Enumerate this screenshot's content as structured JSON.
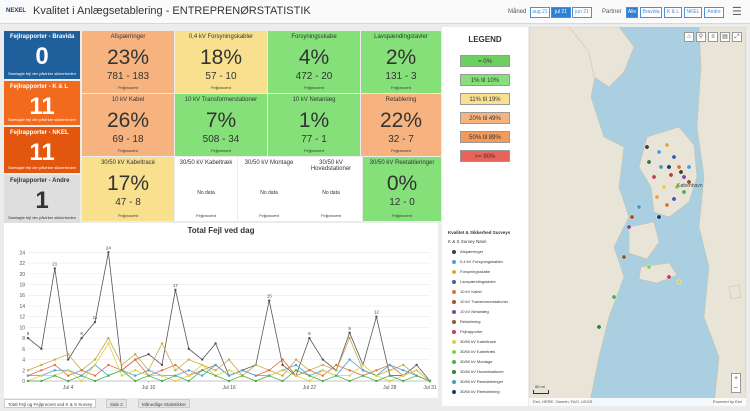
{
  "header": {
    "logo": "NEXEL",
    "title": "Kvalitet i Anlægsetablering - ENTREPRENØRSTATISTIK",
    "month_label": "Måned",
    "months": [
      {
        "label": "aug 21",
        "active": false
      },
      {
        "label": "jul 21",
        "active": true
      },
      {
        "label": "jun 21",
        "active": false
      }
    ],
    "partner_label": "Partner",
    "partners": [
      {
        "label": "Alle",
        "active": true
      },
      {
        "label": "Bravida",
        "active": false
      },
      {
        "label": "K & L",
        "active": false
      },
      {
        "label": "NKEL",
        "active": false
      },
      {
        "label": "Andre",
        "active": false
      }
    ],
    "menu_icon": "hamburger-icon"
  },
  "side_tiles": [
    {
      "title": "Fejlrapporter - Bravida",
      "value": "0",
      "caption": "Samlagte fejl der påvirker sikkerheden",
      "color": "#1f5f9c"
    },
    {
      "title": "Fejlrapporter - K & L",
      "value": "11",
      "caption": "Samlagte fejl der påvirker sikkerheden",
      "color": "#f26a1b"
    },
    {
      "title": "Fejlrapporter - NKEL",
      "value": "11",
      "caption": "Samlagte fejl der påvirker sikkerheden",
      "color": "#e2560e"
    },
    {
      "title": "Fejlrapporter - Andre",
      "value": "1",
      "caption": "Samlagte fejl der påvirker sikkerheden",
      "color": "#dedede",
      "text_color": "#333"
    }
  ],
  "kpi_tiles": [
    {
      "title": "Afspærringer",
      "value": "23%",
      "sub": "781 - 183",
      "caption": "Fejlprocent",
      "color": "#f7b37f"
    },
    {
      "title": "0,4 kV Forsyningskabler",
      "value": "18%",
      "sub": "57 - 10",
      "caption": "Fejlprocent",
      "color": "#f9e08f"
    },
    {
      "title": "Forsyningsskabe",
      "value": "4%",
      "sub": "472 - 20",
      "caption": "Fejlprocent",
      "color": "#85e07a"
    },
    {
      "title": "Lavspændingstavler",
      "value": "2%",
      "sub": "131 - 3",
      "caption": "Fejlprocent",
      "color": "#85e07a"
    },
    {
      "title": "10 kV Kabel",
      "value": "26%",
      "sub": "69 - 18",
      "caption": "Fejlprocent",
      "color": "#f7b37f"
    },
    {
      "title": "10 kV Transformerstationer",
      "value": "7%",
      "sub": "508 - 34",
      "caption": "Fejlprocent",
      "color": "#85e07a"
    },
    {
      "title": "10 kV Netanlæg",
      "value": "1%",
      "sub": "77 - 1",
      "caption": "Fejlprocent",
      "color": "#85e07a"
    },
    {
      "title": "Retablering",
      "value": "22%",
      "sub": "32 - 7",
      "caption": "Fejlprocent",
      "color": "#f7b37f"
    },
    {
      "title": "30/50 kV Kabeltracé",
      "value": "17%",
      "sub": "47 - 8",
      "caption": "Fejlprocent",
      "color": "#f9e08f"
    },
    {
      "title": "30/50 kV Kabeltræk",
      "value": "",
      "sub": "No data",
      "caption": "Fejlprocent",
      "color": "#ffffff"
    },
    {
      "title": "30/50 kV Montage",
      "value": "",
      "sub": "No data",
      "caption": "Fejlprocent",
      "color": "#ffffff"
    },
    {
      "title": "30/50 kV Hovedstationer",
      "value": "",
      "sub": "No data",
      "caption": "Fejlprocent",
      "color": "#ffffff"
    },
    {
      "title": "30/50 kV Reetableringer",
      "value": "0%",
      "sub": "12 - 0",
      "caption": "Fejlprocent",
      "color": "#85e07a"
    }
  ],
  "legend": {
    "title": "LEGEND",
    "bands": [
      {
        "label": "= 0%",
        "color": "#6cd05f"
      },
      {
        "label": "1% til 10%",
        "color": "#85e07a"
      },
      {
        "label": "11% til 19%",
        "color": "#f9e08f"
      },
      {
        "label": "20% til 49%",
        "color": "#f7b37f"
      },
      {
        "label": "50% til 89%",
        "color": "#f29a5c"
      },
      {
        "label": ">= 90%",
        "color": "#e8645a"
      }
    ],
    "survey_title": "Kvalitet & Sikkerhed Surveys",
    "survey_sub": "K & S Survey Navn",
    "items": [
      {
        "label": "Afspærringer",
        "color": "#3f3f3f"
      },
      {
        "label": "0,4 kV Forsyningskabler",
        "color": "#4aa0e0"
      },
      {
        "label": "Forsyningsskabe",
        "color": "#e0a44a"
      },
      {
        "label": "Lavspændingstavler",
        "color": "#3c5fa8"
      },
      {
        "label": "10 kV Kabel",
        "color": "#e0733a"
      },
      {
        "label": "10 kV Transformerstationer",
        "color": "#b04a2a"
      },
      {
        "label": "10 kV Netanlæg",
        "color": "#7a4aa0"
      },
      {
        "label": "Retablering",
        "color": "#8a5a2a"
      },
      {
        "label": "Fejlrapporter",
        "color": "#c83a5a"
      },
      {
        "label": "30/50 kV Kabeltracé",
        "color": "#e0d040"
      },
      {
        "label": "30/50 kV Kabeltræk",
        "color": "#8fd04a"
      },
      {
        "label": "30/50 kV Montage",
        "color": "#4ab050"
      },
      {
        "label": "30/50 kV Hovedstationer",
        "color": "#3a7a40"
      },
      {
        "label": "30/50 kV Reetableringer",
        "color": "#4a9ac0"
      },
      {
        "label": "30/50 kV Reetablering",
        "color": "#1a3a6a"
      }
    ]
  },
  "map": {
    "city_label": "København",
    "scale_label": "50 mi",
    "attribution": "Esri, HERE, Garmin, FAO, USGS",
    "powered": "Powered by Esri",
    "toolbar_icons": [
      "home-icon",
      "search-icon",
      "layers-icon",
      "legend-icon",
      "zoom-out-icon"
    ],
    "zoom_labels": [
      "+",
      "–"
    ],
    "land_color": "#e8e4d8",
    "water_color": "#a9cfe0"
  },
  "tabs": [
    {
      "label": "Total Fejl og Fejlprocent ved K & S Survey",
      "active": true
    },
    {
      "label": "Side 2",
      "active": false
    },
    {
      "label": "Månedlige Statistikker",
      "active": false
    }
  ],
  "chart_data": {
    "type": "line",
    "title": "Total Fejl ved dag",
    "ylim": [
      0,
      25
    ],
    "yticks": [
      0,
      2,
      4,
      6,
      8,
      10,
      12,
      14,
      16,
      18,
      20,
      22,
      24
    ],
    "x_tick_labels": [
      "Jul 4",
      "Jul 10",
      "Jul 16",
      "Jul 22",
      "Jul 28",
      "Jul 31"
    ],
    "x_tick_days": [
      4,
      10,
      16,
      22,
      28,
      31
    ],
    "grid": true,
    "series": [
      {
        "color": "#555555",
        "x": [
          1,
          2,
          3,
          4,
          5,
          6,
          7,
          8,
          9,
          10,
          11,
          12,
          13,
          14,
          15,
          16,
          17,
          18,
          19,
          20,
          21,
          22,
          23,
          24,
          25,
          26,
          27,
          28,
          29,
          30,
          31
        ],
        "y": [
          8,
          6,
          21,
          4,
          8,
          11,
          24,
          2,
          4,
          5,
          3,
          17,
          6,
          4,
          7,
          1,
          2,
          3,
          15,
          3,
          1,
          8,
          4,
          2,
          9,
          3,
          12,
          1,
          1,
          3,
          0
        ]
      },
      {
        "color": "#c8a84a",
        "x": [
          1,
          2,
          3,
          4,
          5,
          6,
          7,
          8,
          9,
          10,
          11,
          12,
          13,
          14,
          15,
          16,
          17,
          18,
          19,
          20,
          21,
          22,
          23,
          24,
          25,
          26,
          27,
          28,
          29,
          30,
          31
        ],
        "y": [
          2,
          3,
          4,
          5,
          2,
          4,
          8,
          3,
          5,
          2,
          7,
          2,
          4,
          3,
          2,
          4,
          1,
          3,
          2,
          1,
          4,
          2,
          3,
          2,
          8,
          2,
          1,
          2,
          3,
          1,
          0
        ]
      },
      {
        "color": "#e0733a",
        "x": [
          1,
          2,
          3,
          4,
          5,
          6,
          7,
          8,
          9,
          10,
          11,
          12,
          13,
          14,
          15,
          16,
          17,
          18,
          19,
          20,
          21,
          22,
          23,
          24,
          25,
          26,
          27,
          28,
          29,
          30,
          31
        ],
        "y": [
          1,
          2,
          3,
          1,
          2,
          1,
          3,
          2,
          4,
          1,
          2,
          3,
          1,
          2,
          3,
          1,
          2,
          1,
          2,
          4,
          1,
          2,
          1,
          3,
          2,
          1,
          2,
          3,
          1,
          2,
          0
        ]
      },
      {
        "color": "#4aa0e0",
        "x": [
          1,
          2,
          3,
          4,
          5,
          6,
          7,
          8,
          9,
          10,
          11,
          12,
          13,
          14,
          15,
          16,
          17,
          18,
          19,
          20,
          21,
          22,
          23,
          24,
          25,
          26,
          27,
          28,
          29,
          30,
          31
        ],
        "y": [
          1,
          1,
          2,
          2,
          1,
          3,
          1,
          2,
          1,
          2,
          1,
          1,
          2,
          1,
          3,
          1,
          2,
          1,
          1,
          2,
          3,
          1,
          2,
          1,
          4,
          2,
          1,
          3,
          2,
          1,
          0
        ]
      },
      {
        "color": "#e0d040",
        "x": [
          1,
          2,
          3,
          4,
          5,
          6,
          7,
          8,
          9,
          10,
          11,
          12,
          13,
          14,
          15,
          16,
          17,
          18,
          19,
          20,
          21,
          22,
          23,
          24,
          25,
          26,
          27,
          28,
          29,
          30,
          31
        ],
        "y": [
          0,
          1,
          1,
          2,
          0,
          3,
          7,
          1,
          2,
          1,
          1,
          0,
          1,
          3,
          1,
          2,
          1,
          0,
          1,
          2,
          1,
          0,
          2,
          1,
          1,
          3,
          1,
          0,
          1,
          2,
          0
        ]
      },
      {
        "color": "#4ab050",
        "x": [
          1,
          2,
          3,
          4,
          5,
          6,
          7,
          8,
          9,
          10,
          11,
          12,
          13,
          14,
          15,
          16,
          17,
          18,
          19,
          20,
          21,
          22,
          23,
          24,
          25,
          26,
          27,
          28,
          29,
          30,
          31
        ],
        "y": [
          0,
          0,
          1,
          0,
          1,
          0,
          1,
          2,
          0,
          1,
          0,
          1,
          0,
          2,
          1,
          0,
          1,
          0,
          1,
          0,
          2,
          1,
          0,
          1,
          0,
          1,
          0,
          1,
          0,
          1,
          0
        ]
      }
    ]
  }
}
